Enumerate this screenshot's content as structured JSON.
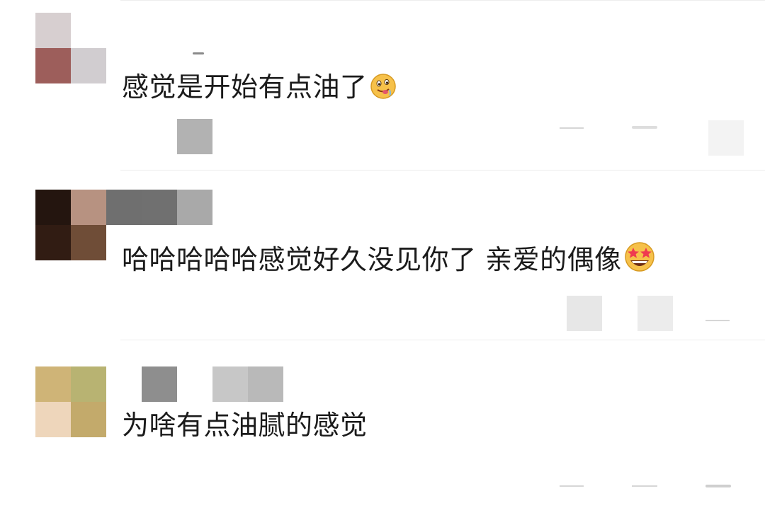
{
  "comments": [
    {
      "text": "感觉是开始有点油了",
      "emoji": "drooling-face"
    },
    {
      "text": "哈哈哈哈哈感觉好久没见你了 亲爱的偶像",
      "emoji": "star-struck-face"
    },
    {
      "text": "为啥有点油腻的感觉",
      "emoji": ""
    }
  ],
  "colors": {
    "text": "#1b1b1b",
    "divider": "#ededed",
    "emoji_face": "#f6c14a"
  }
}
